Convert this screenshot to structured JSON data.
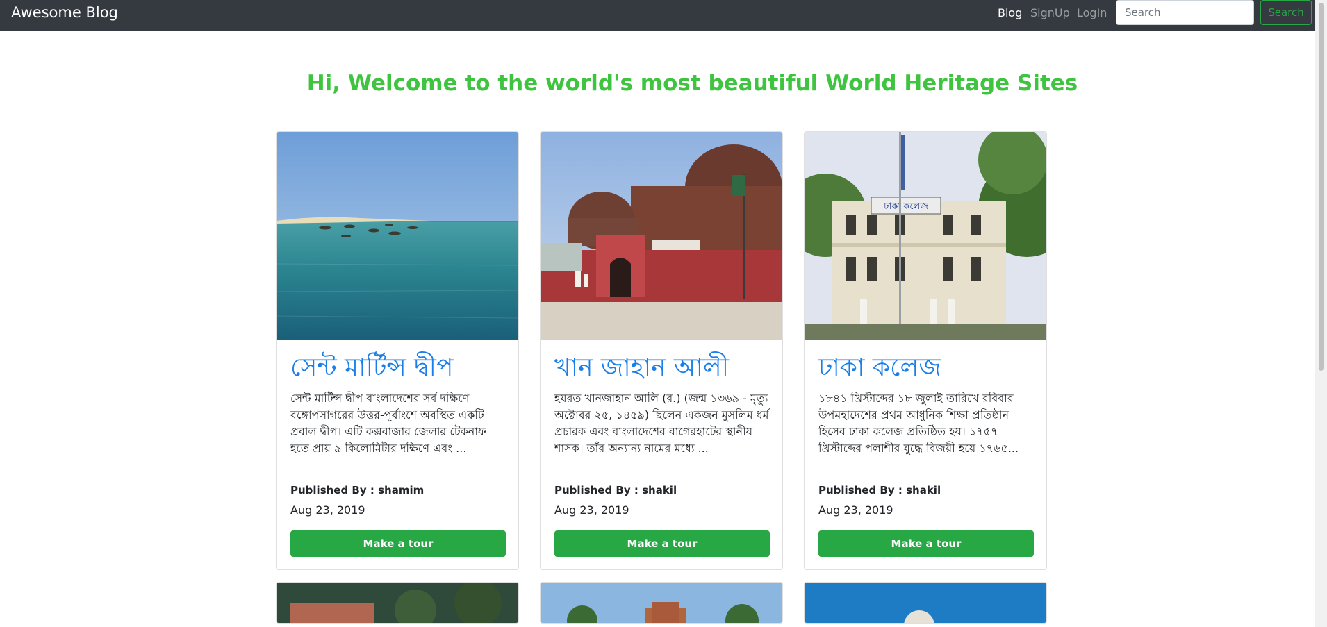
{
  "navbar": {
    "brand": "Awesome Blog",
    "links": [
      {
        "label": "Blog",
        "active": true
      },
      {
        "label": "SignUp",
        "active": false
      },
      {
        "label": "LogIn",
        "active": false
      }
    ],
    "search_placeholder": "Search",
    "search_value": "",
    "search_button": "Search"
  },
  "welcome": "Hi, Welcome to the world's most beautiful World Heritage Sites",
  "cards": [
    {
      "title": "সেন্ট মার্টিন্স দ্বীপ",
      "text": "সেন্ট মার্টিন্স দ্বীপ বাংলাদেশের সর্ব দক্ষিণে বঙ্গোপসাগরের উত্তর-পূর্বাংশে অবস্থিত একটি প্রবাল দ্বীপ। এটি কক্সবাজার জেলার টেকনাফ হতে প্রায় ৯ কিলোমিটার দক্ষিণে এবং ...",
      "author_label": "Published By : ",
      "author": "shamim",
      "date": "Aug 23, 2019",
      "button": "Make a tour",
      "image_icon": "island-sea-photo"
    },
    {
      "title": "খান জাহান আলী",
      "text": "হযরত খানজাহান আলি (র.) (জন্ম ১৩৬৯ - মৃত্যু অক্টোবর ২৫, ১৪৫৯) ছিলেন একজন মুসলিম ধর্ম প্রচারক এবং বাংলাদেশের বাগেরহাটের স্থানীয় শাসক। তাঁর অন্যান্য নামের মধ্যে ...",
      "author_label": "Published By : ",
      "author": "shakil",
      "date": "Aug 23, 2019",
      "button": "Make a tour",
      "image_icon": "mausoleum-photo"
    },
    {
      "title": "ঢাকা কলেজ",
      "text": "১৮৪১ খ্রিস্টাব্দের ১৮ জুলাই তারিখে রবিবার উপমহাদেশের প্রথম আধুনিক শিক্ষা প্রতিষ্ঠান হিসেব ঢাকা কলেজ প্রতিষ্ঠিত হয়। ১৭৫৭ খ্রিস্টাব্দের পলাশীর যুদ্ধে বিজয়ী হয়ে ১৭৬৫...",
      "author_label": "Published By : ",
      "author": "shakil",
      "date": "Aug 23, 2019",
      "button": "Make a tour",
      "image_icon": "college-building-photo",
      "sign_text": "ঢাকা কলেজ"
    }
  ],
  "colors": {
    "navbar_bg": "#343a40",
    "heading": "#3ec43e",
    "title_link": "#1a7ee8",
    "button": "#28a745"
  }
}
